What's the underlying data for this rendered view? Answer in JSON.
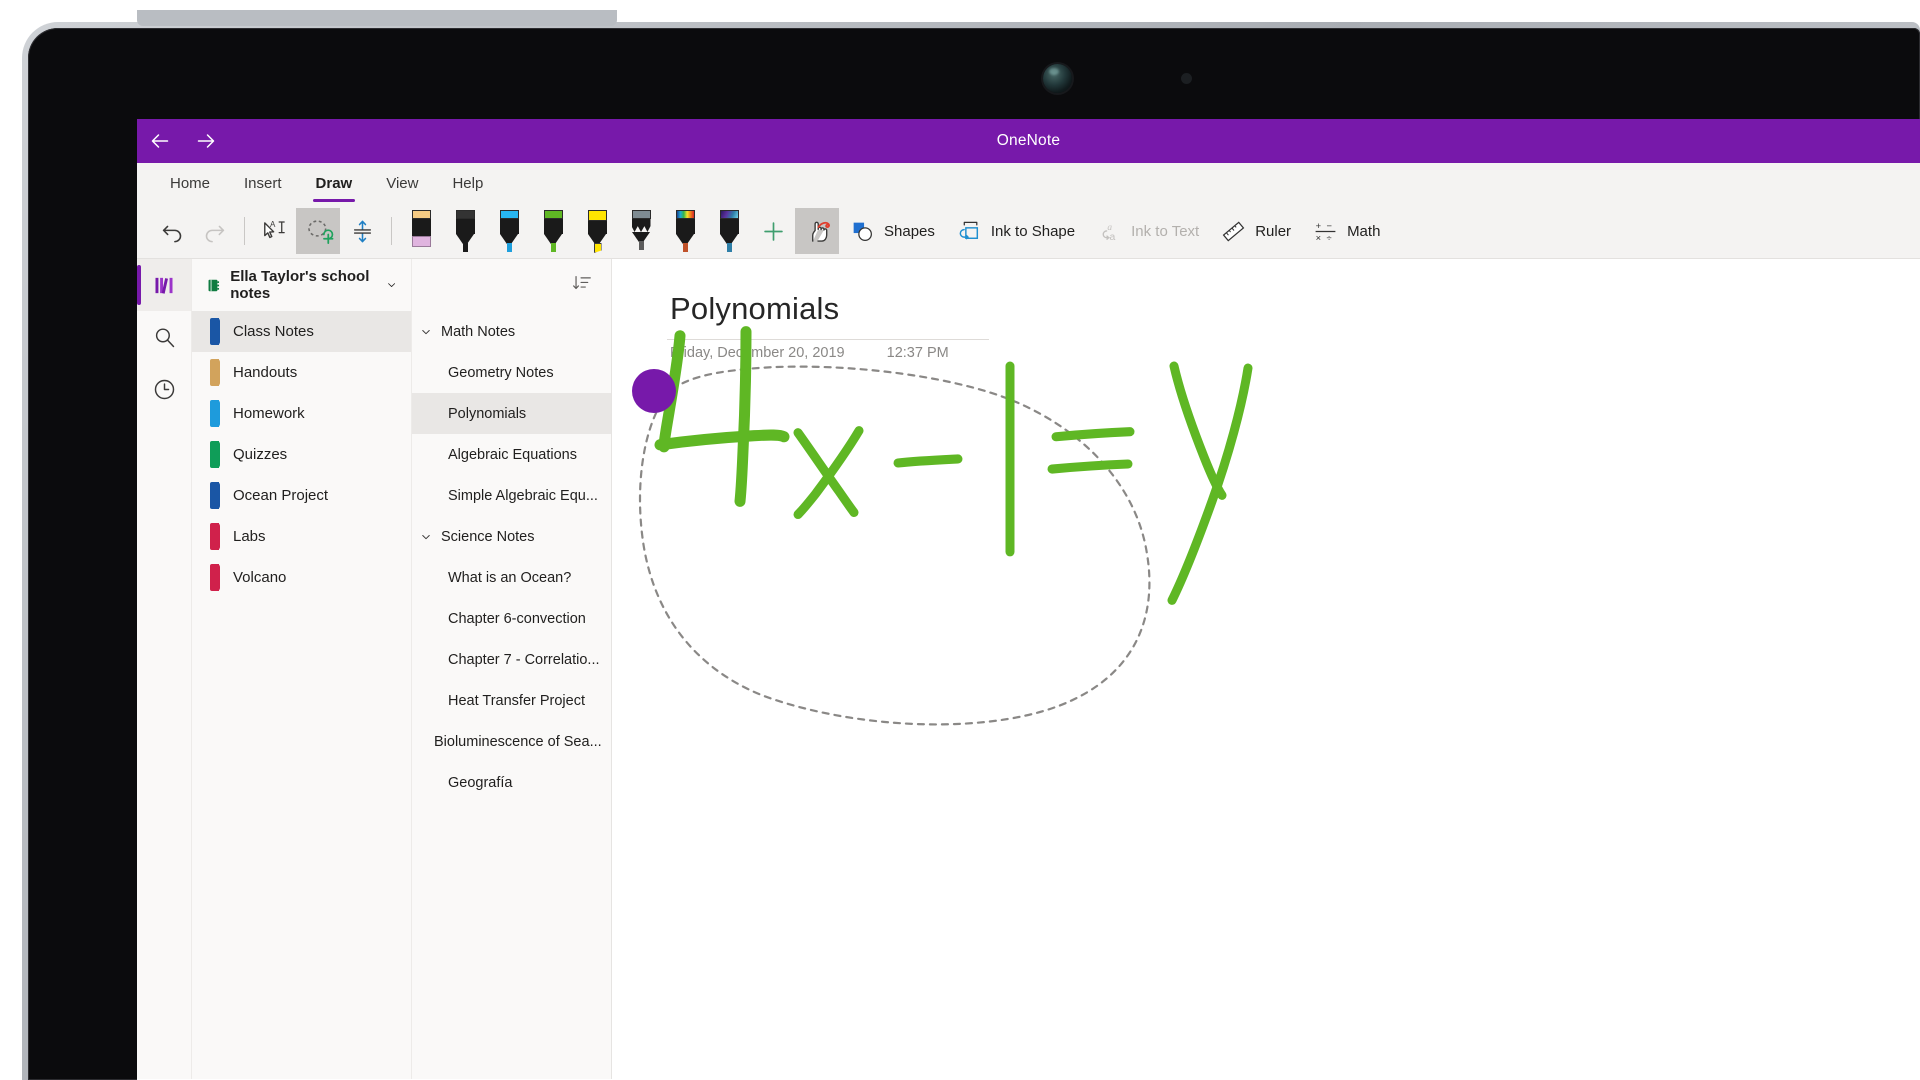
{
  "app": {
    "title": "OneNote",
    "accent_color": "#7719aa",
    "back_icon": "arrow-left-icon",
    "forward_icon": "arrow-right-icon"
  },
  "ribbon": {
    "tabs": [
      {
        "label": "Home",
        "active": false
      },
      {
        "label": "Insert",
        "active": false
      },
      {
        "label": "Draw",
        "active": true
      },
      {
        "label": "View",
        "active": false
      },
      {
        "label": "Help",
        "active": false
      }
    ],
    "tools": [
      {
        "name": "undo",
        "icon": "undo-icon",
        "state": "enabled"
      },
      {
        "name": "redo",
        "icon": "redo-icon",
        "state": "disabled"
      },
      {
        "name": "select-objects-or-type-text",
        "icon": "lasso-text-select-icon",
        "state": "enabled"
      },
      {
        "name": "lasso-select",
        "icon": "lasso-select-icon",
        "state": "selected"
      },
      {
        "name": "ink-thickness",
        "icon": "thickness-arrows-icon",
        "state": "enabled"
      }
    ],
    "pens": [
      {
        "name": "eraser",
        "icon": "eraser-icon",
        "cap_color": "#f5cb84",
        "accent_color": "#e0b4df"
      },
      {
        "name": "pen-black",
        "icon": "pen-icon",
        "cap_color": "#333333",
        "accent_color": "#1a1a1a"
      },
      {
        "name": "pen-blue",
        "icon": "pen-icon",
        "cap_color": "#27b6f2",
        "accent_color": "#1f9fdd"
      },
      {
        "name": "pen-green",
        "icon": "pen-icon",
        "cap_color": "#5fb724",
        "accent_color": "#5fb724"
      },
      {
        "name": "highlighter-yellow",
        "icon": "highlighter-icon",
        "cap_color": "#ffe400",
        "accent_color": "#ffe400"
      },
      {
        "name": "pencil-gray",
        "icon": "pencil-icon",
        "cap_color": "#7e8b92",
        "accent_color": "#7e8b92"
      },
      {
        "name": "pen-rainbow",
        "icon": "pen-rainbow-icon",
        "cap_color": "rainbow",
        "accent_color": "#c0522a"
      },
      {
        "name": "pen-galaxy",
        "icon": "pen-galaxy-icon",
        "cap_color": "galaxy",
        "accent_color": "#2f7fa8"
      }
    ],
    "add_pen": {
      "label": "+",
      "icon": "plus-icon"
    },
    "actions": [
      {
        "label": "Shapes",
        "icon": "shapes-icon",
        "state": "enabled"
      },
      {
        "label": "Ink to Shape",
        "icon": "ink-to-shape-icon",
        "state": "enabled"
      },
      {
        "label": "Ink to Text",
        "icon": "ink-to-text-icon",
        "state": "disabled"
      },
      {
        "label": "Ruler",
        "icon": "ruler-icon",
        "state": "enabled"
      },
      {
        "label": "Math",
        "icon": "math-icon",
        "state": "enabled"
      }
    ]
  },
  "rail": {
    "items": [
      {
        "name": "notebooks",
        "icon": "notebooks-icon",
        "active": true
      },
      {
        "name": "search",
        "icon": "search-icon",
        "active": false
      },
      {
        "name": "recent",
        "icon": "clock-icon",
        "active": false
      }
    ]
  },
  "notebook": {
    "name": "Ella Taylor's school notes",
    "icon": "notebook-icon",
    "icon_color": "#107c41",
    "chevron": "chevron-down-icon",
    "sections": [
      {
        "label": "Class Notes",
        "color": "#1a56a5",
        "selected": true
      },
      {
        "label": "Handouts",
        "color": "#d2a35c",
        "selected": false
      },
      {
        "label": "Homework",
        "color": "#1e9bdc",
        "selected": false
      },
      {
        "label": "Quizzes",
        "color": "#0f9d58",
        "selected": false
      },
      {
        "label": "Ocean Project",
        "color": "#1a56a5",
        "selected": false
      },
      {
        "label": "Labs",
        "color": "#d0214b",
        "selected": false
      },
      {
        "label": "Volcano",
        "color": "#d0214b",
        "selected": false
      }
    ]
  },
  "pages": {
    "sort_icon": "sort-icon",
    "items": [
      {
        "label": "Math Notes",
        "type": "group",
        "chevron": "chevron-down-icon",
        "selected": false
      },
      {
        "label": "Geometry Notes",
        "type": "page",
        "selected": false
      },
      {
        "label": "Polynomials",
        "type": "page",
        "selected": true
      },
      {
        "label": "Algebraic Equations",
        "type": "page",
        "selected": false
      },
      {
        "label": "Simple Algebraic Equ...",
        "type": "page",
        "selected": false
      },
      {
        "label": "Science Notes",
        "type": "group",
        "chevron": "chevron-down-icon",
        "selected": false
      },
      {
        "label": "What is an Ocean?",
        "type": "page",
        "selected": false
      },
      {
        "label": "Chapter 6-convection",
        "type": "page",
        "selected": false
      },
      {
        "label": "Chapter 7 - Correlatio...",
        "type": "page",
        "selected": false
      },
      {
        "label": "Heat Transfer Project",
        "type": "page",
        "selected": false
      },
      {
        "label": "Bioluminescence of Sea...",
        "type": "page",
        "selected": false,
        "outdent": true
      },
      {
        "label": "Geografía",
        "type": "page",
        "selected": false
      }
    ]
  },
  "page": {
    "title": "Polynomials",
    "date": "Friday, December 20, 2019",
    "time": "12:37 PM",
    "ink": {
      "expression": "4x - | = y",
      "ink_color": "#5fb724",
      "selection": {
        "type": "lasso",
        "handle_color": "#7719aa",
        "stroke_color": "#8a8886",
        "dash": "6 6"
      }
    }
  }
}
